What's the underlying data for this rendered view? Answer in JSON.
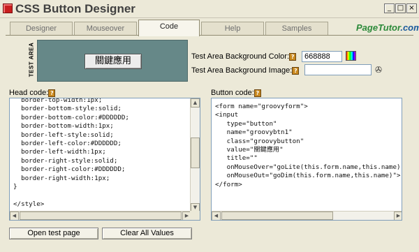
{
  "window": {
    "title": "CSS Button Designer",
    "minimize": "_",
    "maximize": "□",
    "close": "×"
  },
  "tabs": [
    {
      "label": "Designer"
    },
    {
      "label": "Mouseover"
    },
    {
      "label": "Code",
      "active": true
    },
    {
      "label": "Help"
    },
    {
      "label": "Samples"
    }
  ],
  "brand": {
    "name": "PageTutor",
    "suffix": ".com",
    "color": "#2c8a3a"
  },
  "test_area": {
    "label": "TEST AREA",
    "button_label": "關鍵應用",
    "background_color": "#668888"
  },
  "settings": {
    "bg_color_label": "Test Area Background Color:",
    "bg_color_value": "668888",
    "bg_image_label": "Test Area Background Image:",
    "bg_image_value": ""
  },
  "head_code": {
    "label": "Head code:",
    "text": "  border-top-width:1px;\n  border-bottom-style:solid;\n  border-bottom-color:#DDDDDD;\n  border-bottom-width:1px;\n  border-left-style:solid;\n  border-left-color:#DDDDDD;\n  border-left-width:1px;\n  border-right-style:solid;\n  border-right-color:#DDDDDD;\n  border-right-width:1px;\n}\n\n</style>"
  },
  "button_code": {
    "label": "Button code:",
    "text": "<form name=\"groovyform\">\n<input\n   type=\"button\"\n   name=\"groovybtn1\"\n   class=\"groovybutton\"\n   value=\"關鍵應用\"\n   title=\"\"\n   onMouseOver=\"goLite(this.form.name,this.name)\"\n   onMouseOut=\"goDim(this.form.name,this.name)\">\n</form>"
  },
  "actions": {
    "open_test_page": "Open test page",
    "clear_all_values": "Clear All Values"
  },
  "help_glyph": "?"
}
